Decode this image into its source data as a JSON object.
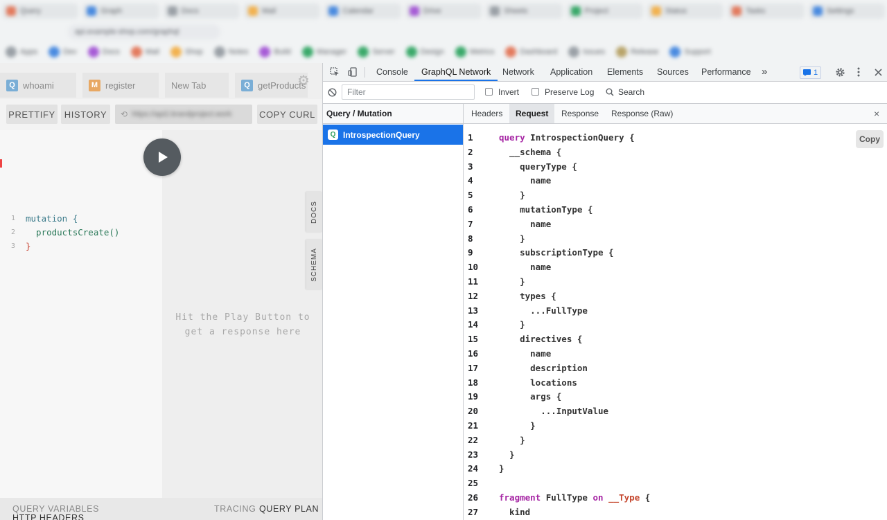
{
  "browser": {
    "tabs": [
      "Query",
      "Graph",
      "Docs",
      "Mail",
      "Calendar",
      "Drive",
      "Sheets",
      "Project",
      "Status",
      "Tasks",
      "Settings"
    ],
    "tab_colors": [
      "#e37b5e",
      "#4a8be0",
      "#9aa0a6",
      "#f2b24f",
      "#4a8be0",
      "#a65bd6",
      "#9aa0a6",
      "#3aa96a",
      "#f2b24f",
      "#e37b5e",
      "#4a8be0"
    ],
    "address": "api.example-shop.com/graphql",
    "bookmarks": [
      "Apps",
      "Dev",
      "Docs",
      "Mail",
      "Shop",
      "Notes",
      "Build",
      "Manager",
      "Server",
      "Design",
      "Metrics",
      "Dashboard",
      "Issues",
      "Release",
      "Support"
    ],
    "bookmark_colors": [
      "#9aa0a6",
      "#4a8be0",
      "#a65bd6",
      "#e37b5e",
      "#f2b24f",
      "#9aa0a6",
      "#a65bd6",
      "#3aa96a",
      "#3aa96a",
      "#3aa96a",
      "#3aa96a",
      "#e37b5e",
      "#9aa0a6",
      "#b8a46a",
      "#4a8be0"
    ]
  },
  "playground": {
    "tabs": [
      {
        "badge": "Q",
        "badge_color": "#7aaed6",
        "label": "whoami"
      },
      {
        "badge": "M",
        "badge_color": "#e8a863",
        "label": "register"
      },
      {
        "badge": "",
        "badge_color": "",
        "label": "New Tab"
      },
      {
        "badge": "Q",
        "badge_color": "#7aaed6",
        "label": "getProducts"
      }
    ],
    "toolbar": {
      "prettify": "PRETTIFY",
      "history": "HISTORY",
      "url": "https://api2.brandproject.work",
      "copy_curl": "COPY CURL"
    },
    "editor": {
      "line_numbers": [
        "1",
        "2",
        "3"
      ],
      "lines": [
        "mutation {",
        "  productsCreate()",
        "}"
      ]
    },
    "hint_line1": "Hit the Play Button to",
    "hint_line2": "get a response here",
    "side_tabs": {
      "docs": "DOCS",
      "schema": "SCHEMA"
    },
    "footer": {
      "query_variables": "QUERY VARIABLES",
      "http_headers": "HTTP HEADERS",
      "tracing": "TRACING",
      "query_plan": "QUERY PLAN"
    }
  },
  "devtools": {
    "tabs": [
      "Console",
      "GraphQL Network",
      "Network",
      "Application",
      "Elements",
      "Sources",
      "Performance"
    ],
    "active_tab": "GraphQL Network",
    "more": "»",
    "issues_count": "1",
    "filter_placeholder": "Filter",
    "invert_label": "Invert",
    "preserve_log_label": "Preserve Log",
    "search_label": "Search",
    "list_header": "Query / Mutation",
    "selected_request": {
      "badge": "Q",
      "name": "IntrospectionQuery"
    },
    "detail_tabs": [
      "Headers",
      "Request",
      "Response",
      "Response (Raw)"
    ],
    "active_detail_tab": "Request",
    "close_symbol": "×",
    "copy_label": "Copy",
    "accent": "#1a73e8",
    "query_lines": [
      {
        "n": "1",
        "text": "query IntrospectionQuery {"
      },
      {
        "n": "2",
        "text": "  __schema {"
      },
      {
        "n": "3",
        "text": "    queryType {"
      },
      {
        "n": "4",
        "text": "      name"
      },
      {
        "n": "5",
        "text": "    }"
      },
      {
        "n": "6",
        "text": "    mutationType {"
      },
      {
        "n": "7",
        "text": "      name"
      },
      {
        "n": "8",
        "text": "    }"
      },
      {
        "n": "9",
        "text": "    subscriptionType {"
      },
      {
        "n": "10",
        "text": "      name"
      },
      {
        "n": "11",
        "text": "    }"
      },
      {
        "n": "12",
        "text": "    types {"
      },
      {
        "n": "13",
        "text": "      ...FullType"
      },
      {
        "n": "14",
        "text": "    }"
      },
      {
        "n": "15",
        "text": "    directives {"
      },
      {
        "n": "16",
        "text": "      name"
      },
      {
        "n": "17",
        "text": "      description"
      },
      {
        "n": "18",
        "text": "      locations"
      },
      {
        "n": "19",
        "text": "      args {"
      },
      {
        "n": "20",
        "text": "        ...InputValue"
      },
      {
        "n": "21",
        "text": "      }"
      },
      {
        "n": "22",
        "text": "    }"
      },
      {
        "n": "23",
        "text": "  }"
      },
      {
        "n": "24",
        "text": "}"
      },
      {
        "n": "25",
        "text": ""
      },
      {
        "n": "26",
        "text": "fragment FullType on __Type {"
      },
      {
        "n": "27",
        "text": "  kind"
      }
    ]
  }
}
